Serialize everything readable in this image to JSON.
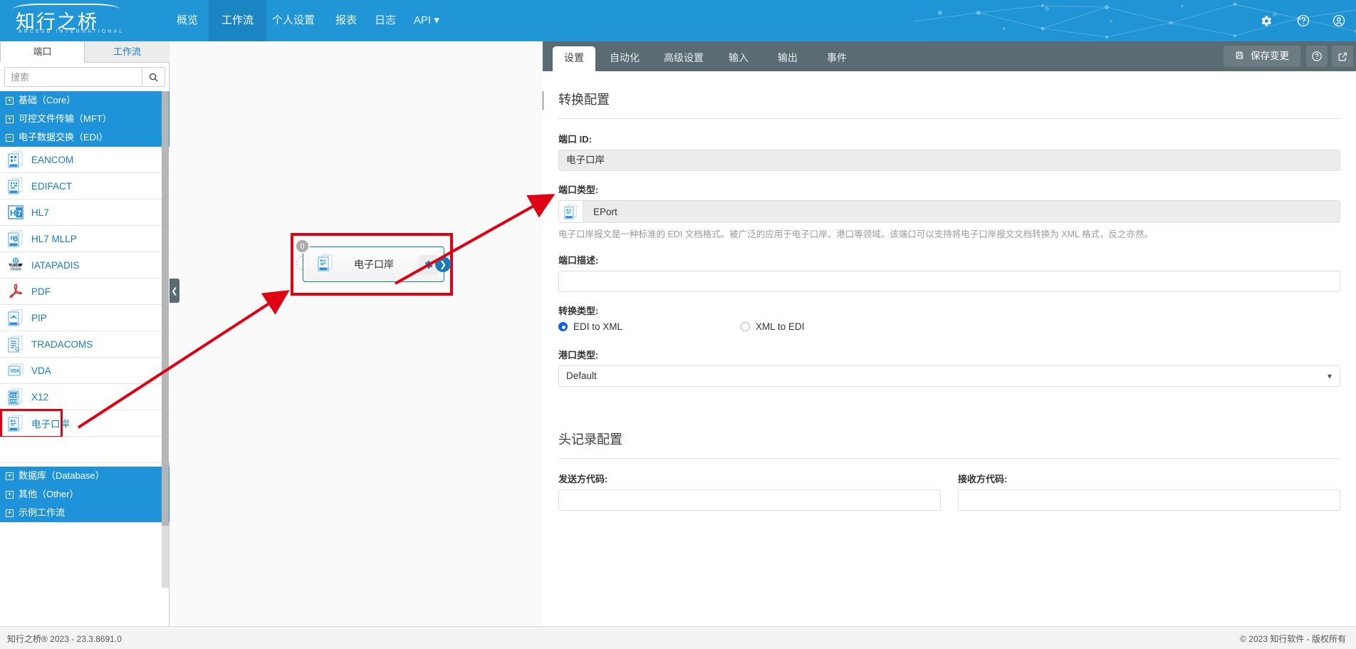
{
  "topnav": {
    "logo_cn": "知行之桥",
    "logo_en": "ARCESB INTERNATIONAL",
    "items": [
      {
        "label": "概览",
        "active": false
      },
      {
        "label": "工作流",
        "active": true
      },
      {
        "label": "个人设置",
        "active": false
      },
      {
        "label": "报表",
        "active": false
      },
      {
        "label": "日志",
        "active": false
      },
      {
        "label": "API ▾",
        "active": false
      }
    ],
    "icons": [
      "gear-icon",
      "help-icon",
      "user-icon"
    ]
  },
  "sidebar": {
    "tabs": [
      {
        "label": "端口",
        "active": true
      },
      {
        "label": "工作流",
        "active": false
      }
    ],
    "search": {
      "value": "",
      "placeholder": "搜索",
      "icon": "search-icon"
    },
    "categories_top": [
      {
        "label": "基础（Core）",
        "sign": "+"
      },
      {
        "label": "可控文件传输（MFT）",
        "sign": "+"
      },
      {
        "label": "电子数据交换（EDI）",
        "sign": "−"
      }
    ],
    "ports": [
      {
        "label": "EANCOM",
        "icon": "eancom-doc-icon",
        "selected": false
      },
      {
        "label": "EDIFACT",
        "icon": "edifact-doc-icon",
        "selected": false
      },
      {
        "label": "HL7",
        "icon": "hl7-icon",
        "selected": false
      },
      {
        "label": "HL7 MLLP",
        "icon": "hl7-mllp-doc-icon",
        "selected": false
      },
      {
        "label": "IATAPADIS",
        "icon": "iata-padis-icon",
        "selected": false
      },
      {
        "label": "PDF",
        "icon": "pdf-icon",
        "selected": false
      },
      {
        "label": "PIP",
        "icon": "pip-doc-icon",
        "selected": false
      },
      {
        "label": "TRADACOMS",
        "icon": "tradacoms-doc-icon",
        "selected": false
      },
      {
        "label": "VDA",
        "icon": "vda-doc-icon",
        "selected": false
      },
      {
        "label": "X12",
        "icon": "x12-doc-icon",
        "selected": false
      },
      {
        "label": "电子口岸",
        "icon": "eport-doc-icon",
        "selected": true
      }
    ],
    "categories_bottom": [
      {
        "label": "数据库（Database）",
        "sign": "+"
      },
      {
        "label": "其他（Other）",
        "sign": "+"
      },
      {
        "label": "示例工作流",
        "sign": "+"
      }
    ]
  },
  "canvas": {
    "collapse_icon": "chevron-left-icon",
    "node": {
      "label": "电子口岸",
      "badge": "0",
      "icon": "eport-doc-icon",
      "gear_icon": "gear-icon",
      "out_icon": "chevron-right-icon",
      "in_icon": "chevron-right-icon"
    }
  },
  "panel": {
    "close_icon": "close-icon",
    "tabs": [
      {
        "label": "设置",
        "active": true
      },
      {
        "label": "自动化",
        "active": false
      },
      {
        "label": "高级设置",
        "active": false
      },
      {
        "label": "输入",
        "active": false
      },
      {
        "label": "输出",
        "active": false
      },
      {
        "label": "事件",
        "active": false
      }
    ],
    "save_label": "保存变更",
    "save_icon": "save-icon",
    "help_icon": "help-icon",
    "popout_icon": "popout-icon",
    "form": {
      "section1_title": "转换配置",
      "port_id_label": "端口 ID:",
      "port_id_value": "电子口岸",
      "port_type_label": "端口类型:",
      "port_type_value": "EPort",
      "port_type_icon": "eport-doc-icon",
      "port_type_help": "电子口岸报文是一种标准的 EDI 文档格式。被广泛的应用于电子口岸、港口等领域。该端口可以支持将电子口岸报文文档转换为 XML 格式，反之亦然。",
      "port_desc_label": "端口描述:",
      "port_desc_value": "",
      "convert_type_label": "转换类型:",
      "convert_options": [
        {
          "label": "EDI to XML",
          "selected": true
        },
        {
          "label": "XML to EDI",
          "selected": false
        }
      ],
      "port_kind_label": "港口类型:",
      "port_kind_value": "Default",
      "port_kind_chevron": "chevron-down-icon",
      "section2_title": "头记录配置",
      "sender_code_label": "发送方代码:",
      "sender_code_value": "",
      "receiver_code_label": "接收方代码:",
      "receiver_code_value": ""
    }
  },
  "footer": {
    "left": "知行之桥® 2023 - 23.3.8691.0",
    "right": "© 2023 知行软件 - 版权所有"
  },
  "colors": {
    "brand_blue": "#2196d6",
    "nav_active": "#1b84c2",
    "panel_gray": "#5b6b74",
    "highlight_red": "#e00014",
    "link_blue": "#1a7bb9"
  }
}
